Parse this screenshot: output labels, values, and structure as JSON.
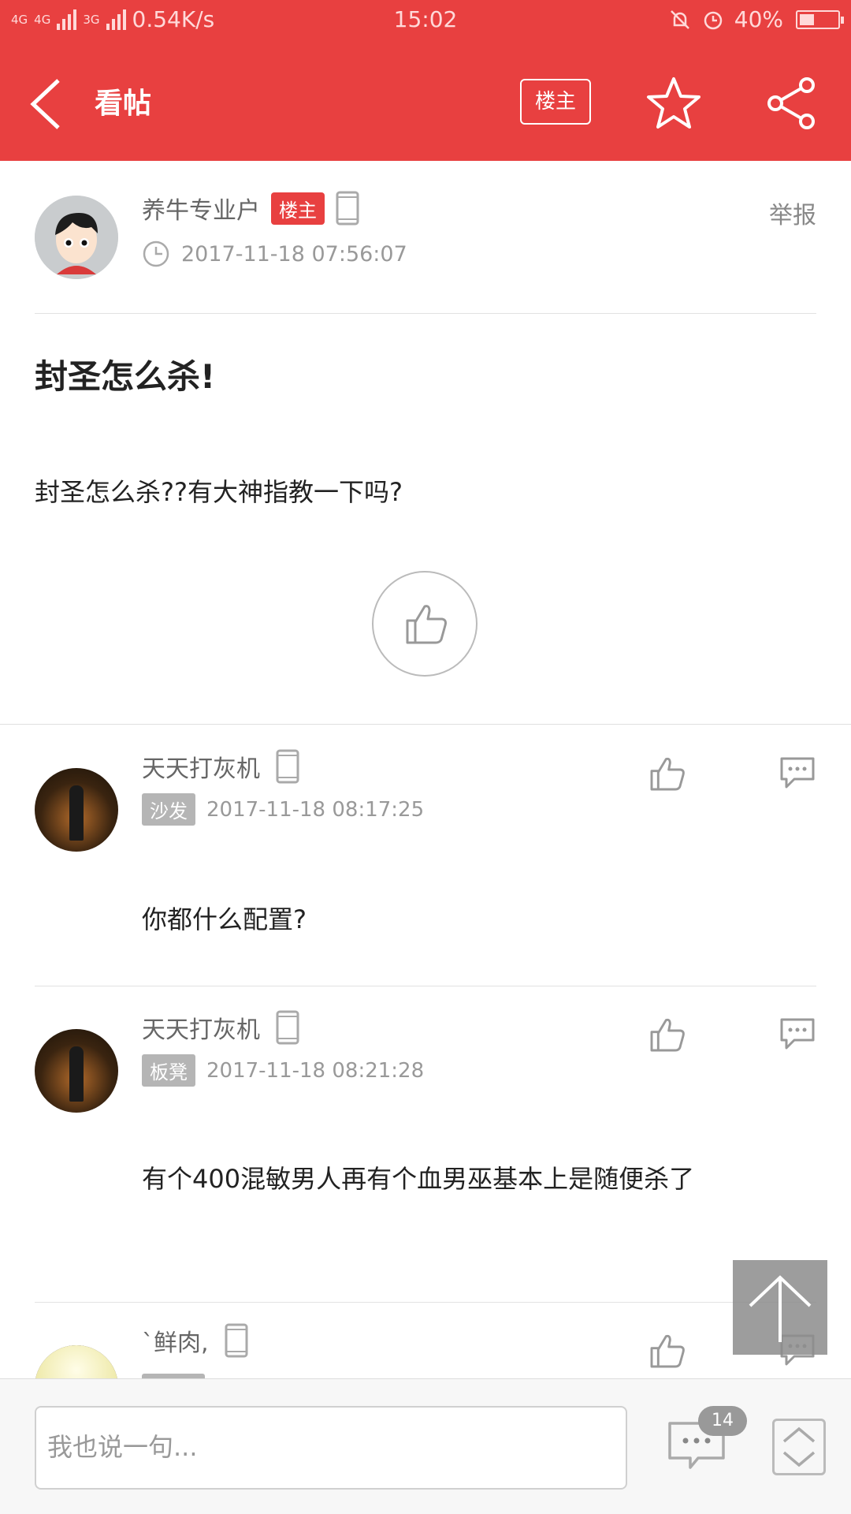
{
  "status_bar": {
    "network_label": "4G",
    "network_label2": "4G",
    "network_label3": "3G",
    "speed": "0.54K/s",
    "time": "15:02",
    "battery_text": "40%",
    "battery_level": 0.4
  },
  "app_bar": {
    "title": "看帖",
    "owner_button": "楼主"
  },
  "post": {
    "author": "养牛专业户",
    "owner_badge": "楼主",
    "date": "2017-11-18 07:56:07",
    "report": "举报",
    "title": "封圣怎么杀!",
    "body": "封圣怎么杀??有大神指教一下吗?"
  },
  "replies": [
    {
      "name": "天天打灰机",
      "badge": "沙发",
      "date": "2017-11-18 08:17:25",
      "text": "你都什么配置?"
    },
    {
      "name": "天天打灰机",
      "badge": "板凳",
      "date": "2017-11-18 08:21:28",
      "text": "有个400混敏男人再有个血男巫基本上是随便杀了"
    },
    {
      "name": "`鲜肉,",
      "badge": "",
      "date": "",
      "text": ""
    }
  ],
  "bottom_bar": {
    "placeholder": "我也说一句...",
    "comment_count": "14"
  },
  "colors": {
    "brand": "#e84040",
    "gray_badge": "#b5b5b5"
  }
}
